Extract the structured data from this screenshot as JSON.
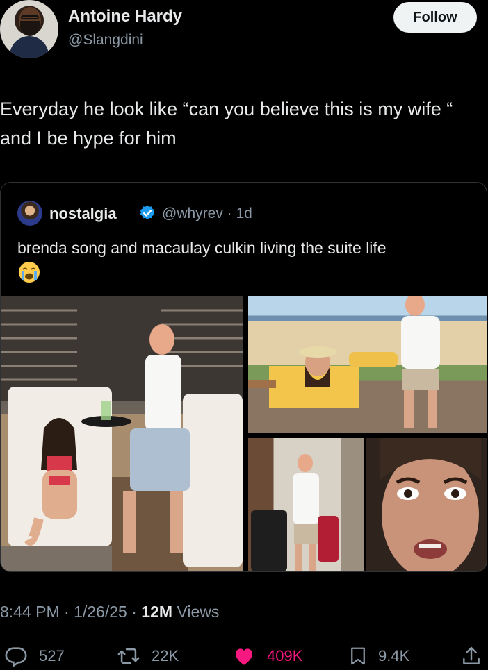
{
  "author": {
    "name": "Antoine Hardy",
    "handle": "@Slangdini",
    "follow_label": "Follow"
  },
  "tweet": {
    "text": "Everyday he look like “can you believe this is my wife “  and I be hype for him"
  },
  "quoted": {
    "name": "nostalgia",
    "handle_time": "@whyrev · 1d",
    "text": "brenda song and macaulay culkin living the suite life",
    "emoji": "loudly-crying-face-icon"
  },
  "meta": {
    "time_date": "8:44 PM · 1/26/25 · ",
    "views_count": "12M",
    "views_label": " Views"
  },
  "actions": {
    "replies": "527",
    "retweets": "22K",
    "likes": "409K",
    "bookmarks": "9.4K"
  },
  "colors": {
    "background": "#000000",
    "like": "#f91880",
    "verified": "#1d9bf0",
    "muted": "#8b98a5"
  }
}
